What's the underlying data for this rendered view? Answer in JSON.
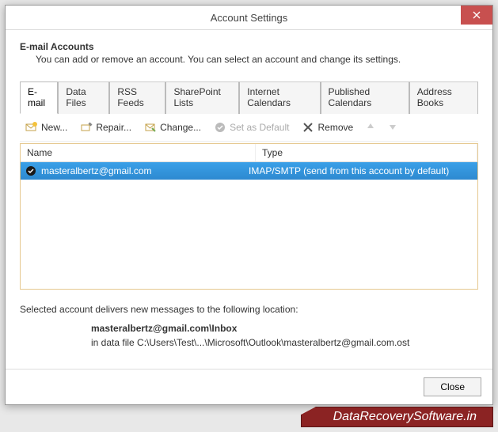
{
  "titlebar": {
    "title": "Account Settings"
  },
  "header": {
    "title": "E-mail Accounts",
    "subtitle": "You can add or remove an account. You can select an account and change its settings."
  },
  "tabs": [
    {
      "label": "E-mail",
      "active": true
    },
    {
      "label": "Data Files"
    },
    {
      "label": "RSS Feeds"
    },
    {
      "label": "SharePoint Lists"
    },
    {
      "label": "Internet Calendars"
    },
    {
      "label": "Published Calendars"
    },
    {
      "label": "Address Books"
    }
  ],
  "toolbar": {
    "new": "New...",
    "repair": "Repair...",
    "change": "Change...",
    "set_default": "Set as Default",
    "remove": "Remove"
  },
  "columns": {
    "name": "Name",
    "type": "Type"
  },
  "accounts": [
    {
      "name": "masteralbertz@gmail.com",
      "type": "IMAP/SMTP (send from this account by default)"
    }
  ],
  "location": {
    "intro": "Selected account delivers new messages to the following location:",
    "mailbox": "masteralbertz@gmail.com\\Inbox",
    "path": "in data file C:\\Users\\Test\\...\\Microsoft\\Outlook\\masteralbertz@gmail.com.ost"
  },
  "buttons": {
    "close": "Close"
  },
  "watermark": "DataRecoverySoftware.in"
}
